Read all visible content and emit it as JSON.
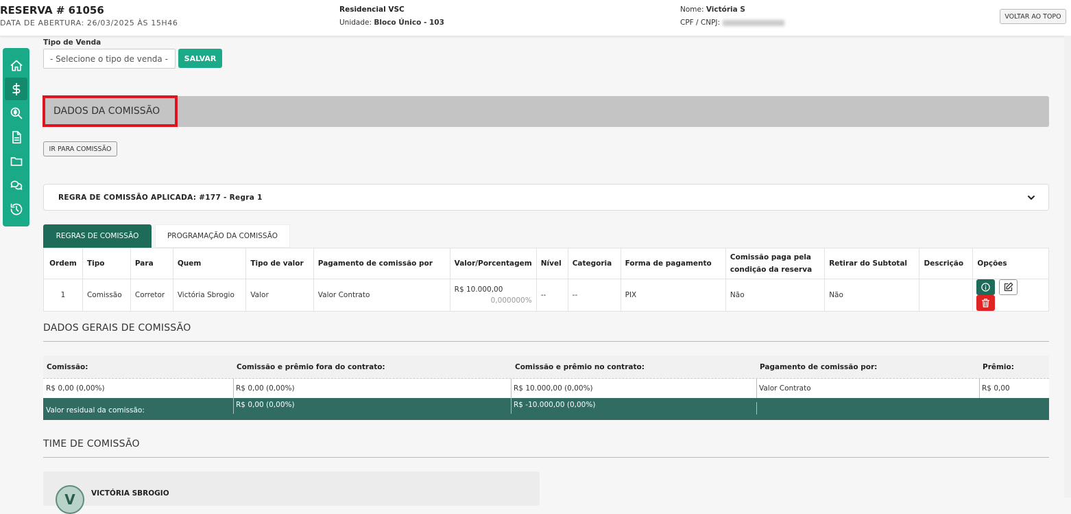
{
  "header": {
    "reserva_title": "RESERVA # 61056",
    "data_abertura": "DATA DE ABERTURA: 26/03/2025 ÀS 15H46",
    "empreendimento": "Residencial VSC",
    "unidade_label": "Unidade:",
    "unidade_value": "Bloco Único - 103",
    "nome_label": "Nome:",
    "nome_value": "Victória S",
    "cpf_label": "CPF / CNPJ:",
    "voltar_label": "VOLTAR AO TOPO"
  },
  "sidebar": {
    "items": [
      {
        "icon": "home-icon"
      },
      {
        "icon": "dollar-icon",
        "active": true
      },
      {
        "icon": "search-dollar-icon"
      },
      {
        "icon": "document-icon"
      },
      {
        "icon": "folder-icon"
      },
      {
        "icon": "chat-icon"
      },
      {
        "icon": "history-icon"
      }
    ],
    "color": "#1aaa88"
  },
  "tipo_venda": {
    "label": "Tipo de Venda",
    "placeholder": "- Selecione o tipo de venda -",
    "save_label": "SALVAR"
  },
  "comissao_section": {
    "title": "DADOS DA COMISSÃO",
    "ir_label": "IR PARA COMISSÃO",
    "regra_aplicada": "REGRA DE COMISSÃO APLICADA: #177 - Regra 1"
  },
  "tabs": [
    {
      "label": "REGRAS DE COMISSÃO",
      "active": true
    },
    {
      "label": "PROGRAMAÇÃO DA COMISSÃO",
      "active": false
    }
  ],
  "rules_table": {
    "headers": [
      "Ordem",
      "Tipo",
      "Para",
      "Quem",
      "Tipo de valor",
      "Pagamento de comissão por",
      "Valor/Porcentagem",
      "Nível",
      "Categoria",
      "Forma de pagamento",
      "Comissão paga pela condição da reserva",
      "Retirar do Subtotal",
      "Descrição",
      "Opções"
    ],
    "rows": [
      {
        "ordem": "1",
        "tipo": "Comissão",
        "para": "Corretor",
        "quem": "Victória Sbrogio",
        "tipo_valor": "Valor",
        "pagamento": "Valor Contrato",
        "valor": "R$ 10.000,00",
        "porcentagem": "0,000000%",
        "nivel": "--",
        "categoria": "--",
        "forma": "PIX",
        "paga_condicao": "Não",
        "retirar": "Não",
        "descricao": ""
      }
    ]
  },
  "dados_gerais": {
    "title": "DADOS GERAIS DE COMISSÃO",
    "headers": [
      "Comissão:",
      "Comissão e prêmio fora do contrato:",
      "Comissão e prêmio no contrato:",
      "Pagamento de comissão por:",
      "Prêmio:"
    ],
    "values": [
      "R$ 0,00 (0,00%)",
      "R$ 0,00 (0,00%)",
      "R$ 10.000,00 (0,00%)",
      "Valor Contrato",
      "R$ 0,00"
    ],
    "residual_label": "Valor residual da comissão:",
    "residual_values": [
      "R$ 0,00 (0,00%)",
      "R$ -10.000,00 (0,00%)"
    ]
  },
  "time_comissao": {
    "title": "TIME DE COMISSÃO",
    "member_initial": "V",
    "member_name": "VICTÓRIA SBROGIO"
  },
  "colors": {
    "accent": "#1aaa88",
    "dark_green": "#1e6b5a",
    "highlight": "#e0141e",
    "danger": "#e02424"
  }
}
